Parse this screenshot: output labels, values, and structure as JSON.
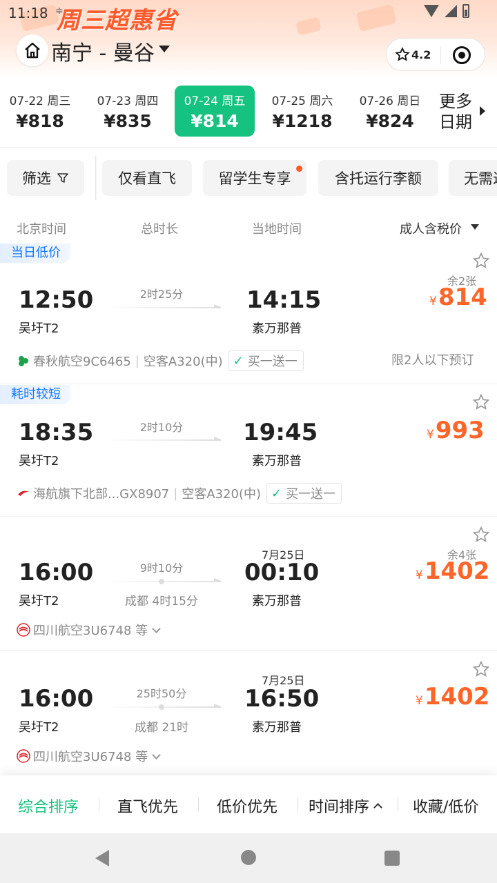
{
  "status": {
    "time": "11:18",
    "extra": "≑"
  },
  "header": {
    "banner": "周三超惠省",
    "route": "南宁 - 曼谷",
    "rating": "4.2"
  },
  "dates": [
    {
      "label": "07-22 周三",
      "price": "¥818",
      "active": false
    },
    {
      "label": "07-23 周四",
      "price": "¥835",
      "active": false
    },
    {
      "label": "07-24 周五",
      "price": "¥814",
      "active": true
    },
    {
      "label": "07-25 周六",
      "price": "¥1218",
      "active": false
    },
    {
      "label": "07-26 周日",
      "price": "¥824",
      "active": false
    }
  ],
  "more_dates": "更多日期",
  "filters": {
    "filter": "筛选",
    "direct_only": "仅看直飞",
    "student": "留学生专享",
    "baggage": "含托运行李额",
    "no_visa": "无需过境签"
  },
  "columns": {
    "beijing_time": "北京时间",
    "total_duration": "总时长",
    "local_time": "当地时间",
    "price_sort": "成人含税价"
  },
  "flights": [
    {
      "tag": "当日低价",
      "dep_time": "12:50",
      "dep_airport": "吴圩T2",
      "duration": "2时25分",
      "arr_time": "14:15",
      "arr_airport": "素万那普",
      "seats": "余2张",
      "currency": "¥",
      "price": "814",
      "airline": "春秋航空9C6465",
      "aircraft": "空客A320(中)",
      "promo": "买一送一",
      "limit": "限2人以下预订"
    },
    {
      "tag": "耗时较短",
      "dep_time": "18:35",
      "dep_airport": "吴圩T2",
      "duration": "2时10分",
      "arr_time": "19:45",
      "arr_airport": "素万那普",
      "currency": "¥",
      "price": "993",
      "airline": "海航旗下北部...GX8907",
      "aircraft": "空客A320(中)",
      "promo": "买一送一"
    },
    {
      "dep_time": "16:00",
      "dep_airport": "吴圩T2",
      "duration": "9时10分",
      "stopover": "成都  4时15分",
      "next_day": "7月25日",
      "arr_time": "00:10",
      "arr_airport": "素万那普",
      "seats": "余4张",
      "currency": "¥",
      "price": "1402",
      "airline": "四川航空3U6748 等"
    },
    {
      "dep_time": "16:00",
      "dep_airport": "吴圩T2",
      "duration": "25时50分",
      "stopover": "成都  21时",
      "next_day": "7月25日",
      "arr_time": "16:50",
      "arr_airport": "素万那普",
      "currency": "¥",
      "price": "1402",
      "airline": "四川航空3U6748 等"
    }
  ],
  "sort_bar": {
    "overall": "综合排序",
    "direct_first": "直飞优先",
    "low_price_first": "低价优先",
    "time_sort": "时间排序",
    "favorites": "收藏/低价"
  },
  "colors": {
    "accent_green": "#16c27f",
    "price_orange": "#ff6528",
    "tag_blue": "#1677ff"
  }
}
